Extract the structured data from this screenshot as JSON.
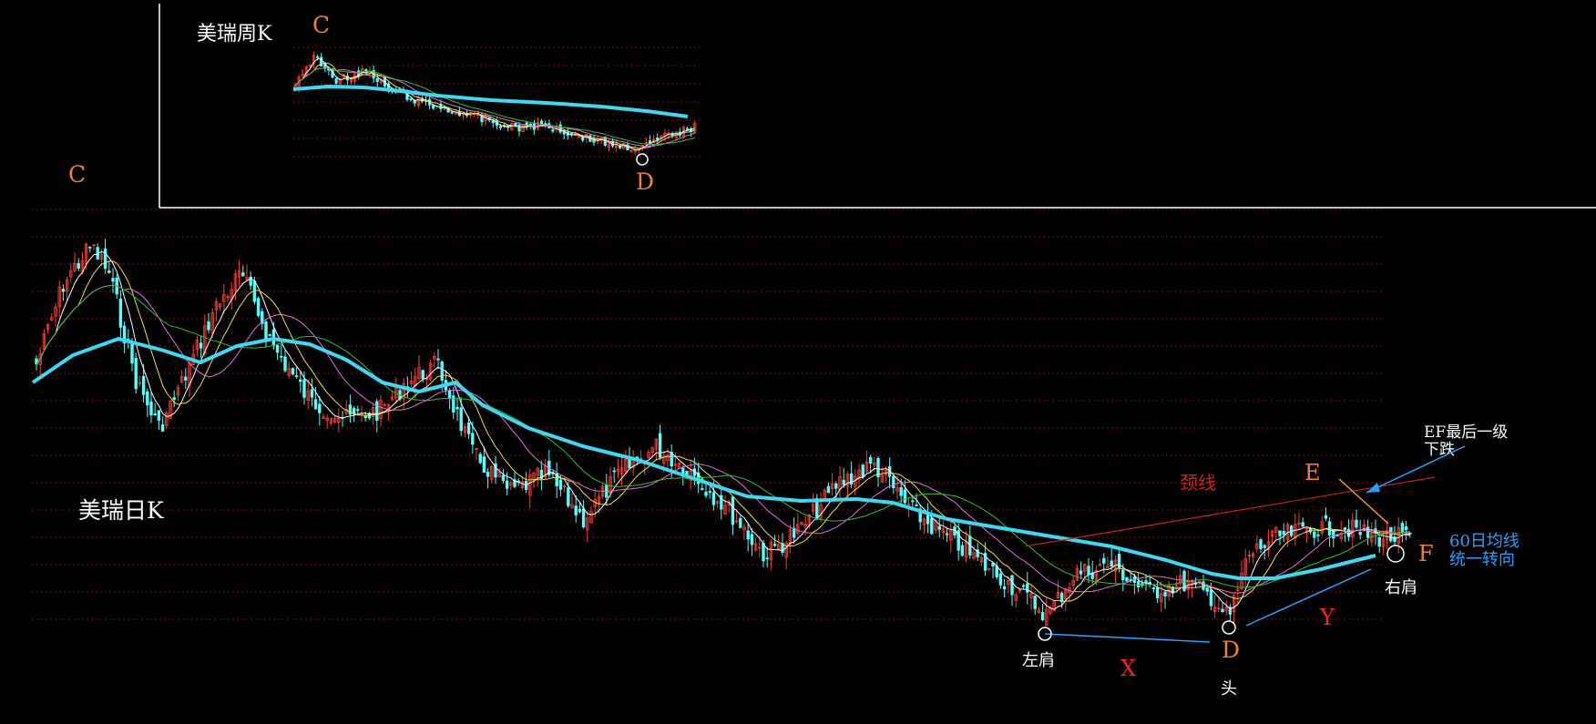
{
  "weekly": {
    "title": "美瑞周K",
    "peak_label": "C",
    "low_label": "D"
  },
  "daily": {
    "title": "美瑞日K",
    "peak_label": "C",
    "neckline_label": "颈线",
    "left_shoulder_label": "左肩",
    "head_label": "头",
    "right_shoulder_label": "右肩",
    "head_point_label": "D",
    "e_label": "E",
    "f_label": "F",
    "x_label": "X",
    "y_label": "Y",
    "ef_note_line1": "EF最后一级",
    "ef_note_line2": "下跌",
    "ma_note_line1": "60日均线",
    "ma_note_line2": "统一转向"
  },
  "colors": {
    "background": "#000000",
    "up_candle": "#ff3b30",
    "down_candle": "#54ffff",
    "ma60": "#3fd8f0",
    "ma5": "#ffffff",
    "ma10": "#f0e040",
    "ma20": "#e070e0",
    "ma30": "#30c030",
    "grid": "#7a1010",
    "peak_text": "#f08040",
    "neckline": "#cc2020",
    "xy_text": "#ff2020",
    "ef_line": "#f0a030",
    "blue_note": "#2a9fff",
    "shoulder_line": "#2a9fff"
  },
  "chart_data": [
    {
      "type": "candlestick",
      "title": "美瑞周K",
      "series": [
        {
          "name": "MA60",
          "trend": [
            1.0,
            0.98,
            0.95,
            0.9,
            0.86,
            0.8,
            0.72,
            0.62
          ]
        }
      ],
      "annotations": [
        "C",
        "D"
      ]
    },
    {
      "type": "candlestick",
      "title": "美瑞日K",
      "series": [
        {
          "name": "MA60",
          "trend": [
            0.18,
            0.3,
            0.25,
            0.35,
            0.55,
            0.65,
            0.72,
            0.78,
            0.88,
            0.8,
            0.72
          ]
        }
      ],
      "annotations": [
        "C",
        "颈线",
        "左肩",
        "头",
        "右肩",
        "D",
        "E",
        "F",
        "X",
        "Y",
        "EF最后一级下跌",
        "60日均线统一转向"
      ]
    }
  ]
}
